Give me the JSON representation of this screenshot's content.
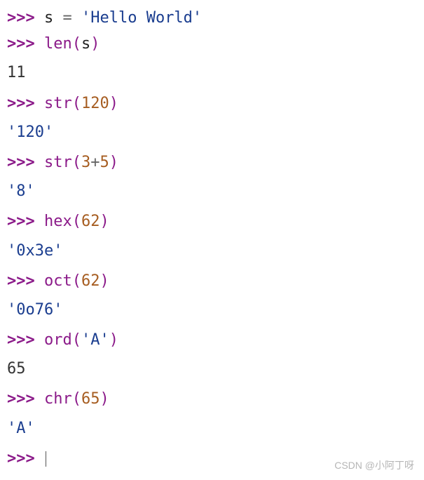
{
  "prompt": ">>> ",
  "lines": {
    "l1": {
      "var": "s",
      "eq": " = ",
      "str": "'Hello World'"
    },
    "l2": {
      "func": "len",
      "lp": "(",
      "arg": "s",
      "rp": ")"
    },
    "o2": "11",
    "l3": {
      "func": "str",
      "lp": "(",
      "num": "120",
      "rp": ")"
    },
    "o3": "'120'",
    "l4": {
      "func": "str",
      "lp": "(",
      "n1": "3",
      "plus": "+",
      "n2": "5",
      "rp": ")"
    },
    "o4": "'8'",
    "l5": {
      "func": "hex",
      "lp": "(",
      "num": "62",
      "rp": ")"
    },
    "o5": "'0x3e'",
    "l6": {
      "func": "oct",
      "lp": "(",
      "num": "62",
      "rp": ")"
    },
    "o6": "'0o76'",
    "l7": {
      "func": "ord",
      "lp": "(",
      "str": "'A'",
      "rp": ")"
    },
    "o7": "65",
    "l8": {
      "func": "chr",
      "lp": "(",
      "num": "65",
      "rp": ")"
    },
    "o8": "'A'",
    "watermark": "CSDN @小阿丁呀"
  }
}
